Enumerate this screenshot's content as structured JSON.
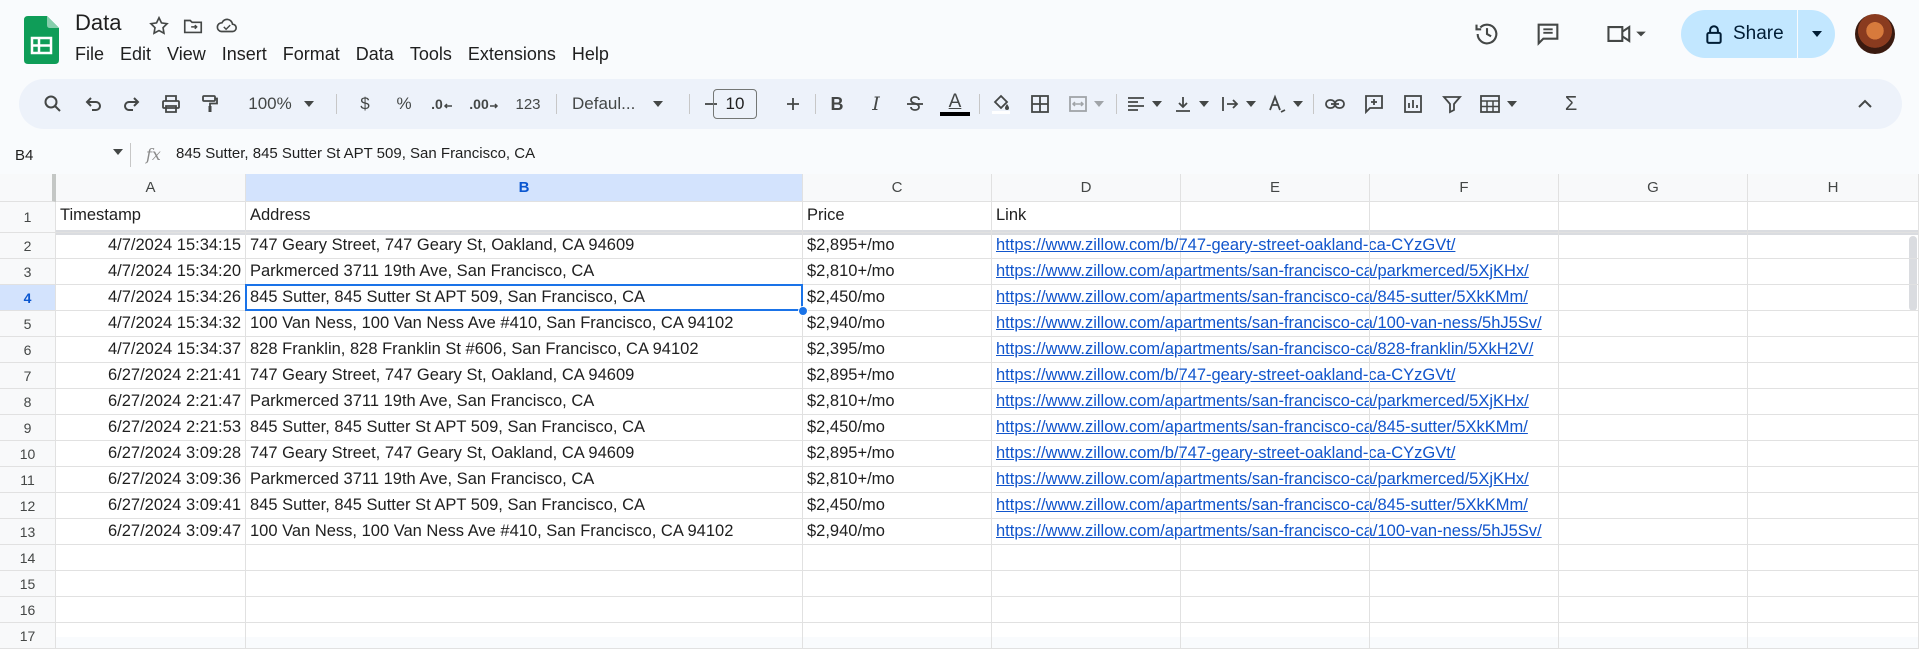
{
  "header": {
    "title": "Data",
    "menu": [
      "File",
      "Edit",
      "View",
      "Insert",
      "Format",
      "Data",
      "Tools",
      "Extensions",
      "Help"
    ],
    "share_label": "Share"
  },
  "toolbar": {
    "zoom": "100%",
    "currency": "$",
    "percent": "%",
    "dec_decrease": ".0",
    "dec_increase": ".00",
    "format_number": "123",
    "font": "Defaul...",
    "font_size": "10",
    "bold": "B",
    "italic": "I",
    "text_color": "A",
    "sum": "Σ"
  },
  "formula_bar": {
    "name_box": "B4",
    "fx": "fx",
    "content": "845 Sutter, 845 Sutter St APT 509, San Francisco, CA"
  },
  "grid": {
    "columns": [
      "A",
      "B",
      "C",
      "D",
      "E",
      "F",
      "G",
      "H"
    ],
    "selected_column": "B",
    "selected_row": "4",
    "row_numbers": [
      "1",
      "2",
      "3",
      "4",
      "5",
      "6",
      "7",
      "8",
      "9",
      "10",
      "11",
      "12",
      "13",
      "14",
      "15",
      "16",
      "17"
    ],
    "header_row": [
      "Timestamp",
      "Address",
      "Price",
      "Link"
    ],
    "rows": [
      [
        "4/7/2024 15:34:15",
        "747 Geary Street, 747 Geary St, Oakland, CA 94609",
        "$2,895+/mo",
        "https://www.zillow.com/b/747-geary-street-oakland-ca-CYzGVt/"
      ],
      [
        "4/7/2024 15:34:20",
        "Parkmerced  3711 19th Ave, San Francisco, CA",
        "$2,810+/mo",
        "https://www.zillow.com/apartments/san-francisco-ca/parkmerced/5XjKHx/"
      ],
      [
        "4/7/2024 15:34:26",
        "845 Sutter, 845 Sutter St APT 509, San Francisco, CA",
        "$2,450/mo",
        "https://www.zillow.com/apartments/san-francisco-ca/845-sutter/5XkKMm/"
      ],
      [
        "4/7/2024 15:34:32",
        "100 Van Ness, 100 Van Ness Ave #410, San Francisco, CA 94102",
        "$2,940/mo",
        "https://www.zillow.com/apartments/san-francisco-ca/100-van-ness/5hJ5Sv/"
      ],
      [
        "4/7/2024 15:34:37",
        "828 Franklin, 828 Franklin St #606, San Francisco, CA 94102",
        "$2,395/mo",
        "https://www.zillow.com/apartments/san-francisco-ca/828-franklin/5XkH2V/"
      ],
      [
        "6/27/2024 2:21:41",
        "747 Geary Street, 747 Geary St, Oakland, CA 94609",
        "$2,895+/mo",
        "https://www.zillow.com/b/747-geary-street-oakland-ca-CYzGVt/"
      ],
      [
        "6/27/2024 2:21:47",
        "Parkmerced  3711 19th Ave, San Francisco, CA",
        "$2,810+/mo",
        "https://www.zillow.com/apartments/san-francisco-ca/parkmerced/5XjKHx/"
      ],
      [
        "6/27/2024 2:21:53",
        "845 Sutter, 845 Sutter St APT 509, San Francisco, CA",
        "$2,450/mo",
        "https://www.zillow.com/apartments/san-francisco-ca/845-sutter/5XkKMm/"
      ],
      [
        "6/27/2024 3:09:28",
        "747 Geary Street, 747 Geary St, Oakland, CA 94609",
        "$2,895+/mo",
        "https://www.zillow.com/b/747-geary-street-oakland-ca-CYzGVt/"
      ],
      [
        "6/27/2024 3:09:36",
        "Parkmerced  3711 19th Ave, San Francisco, CA",
        "$2,810+/mo",
        "https://www.zillow.com/apartments/san-francisco-ca/parkmerced/5XjKHx/"
      ],
      [
        "6/27/2024 3:09:41",
        "845 Sutter, 845 Sutter St APT 509, San Francisco, CA",
        "$2,450/mo",
        "https://www.zillow.com/apartments/san-francisco-ca/845-sutter/5XkKMm/"
      ],
      [
        "6/27/2024 3:09:47",
        "100 Van Ness, 100 Van Ness Ave #410, San Francisco, CA 94102",
        "$2,940/mo",
        "https://www.zillow.com/apartments/san-francisco-ca/100-van-ness/5hJ5Sv/"
      ]
    ]
  },
  "colors": {
    "accent": "#1a73e8",
    "link": "#1155cc",
    "share_bg": "#c2e7ff",
    "selected_header": "#d3e3fd"
  }
}
